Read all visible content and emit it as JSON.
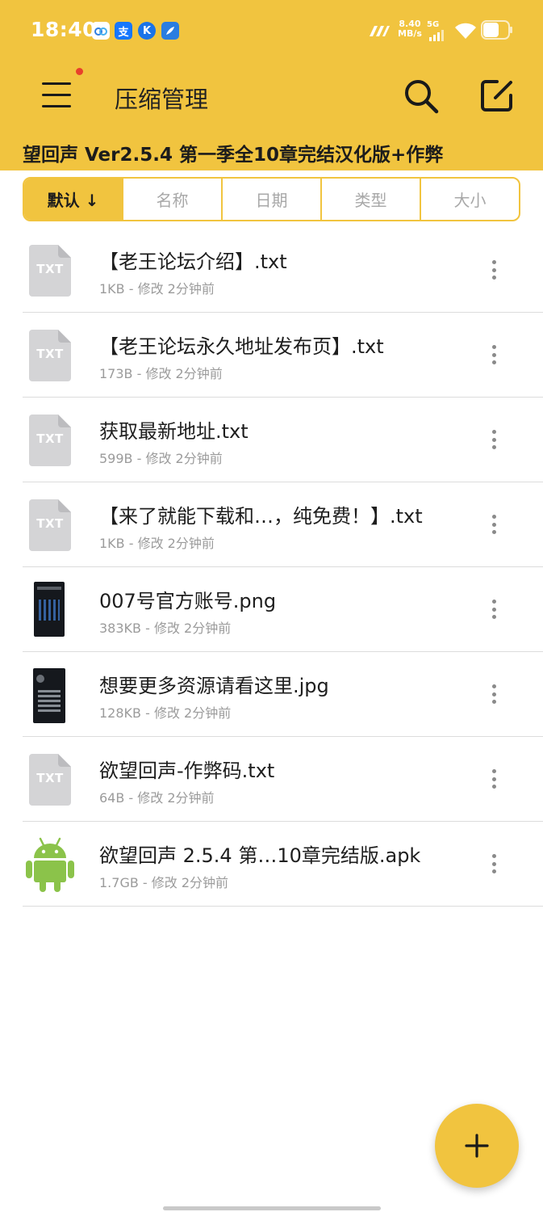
{
  "status_bar": {
    "time": "18:40",
    "apps": [
      "baidu-netdisk-icon",
      "alipay-icon",
      "k-app-icon",
      "feather-app-icon"
    ],
    "alipay_glyph": "支",
    "k_glyph": "K",
    "net_speed_value": "8.40",
    "net_speed_unit": "MB/s",
    "network": "5G",
    "battery_level": 0.6
  },
  "header": {
    "title": "压缩管理",
    "archive_path": "望回声 Ver2.5.4 第一季全10章完结汉化版+作弊",
    "has_notification": true
  },
  "sort_tabs": [
    {
      "label": "默认 ↓",
      "active": true
    },
    {
      "label": "名称",
      "active": false
    },
    {
      "label": "日期",
      "active": false
    },
    {
      "label": "类型",
      "active": false
    },
    {
      "label": "大小",
      "active": false
    }
  ],
  "files": [
    {
      "name": "【老王论坛介绍】.txt",
      "meta": "1KB - 修改 2分钟前",
      "icon": "txt-file-icon",
      "icon_label": "TXT"
    },
    {
      "name": "【老王论坛永久地址发布页】.txt",
      "meta": "173B - 修改 2分钟前",
      "icon": "txt-file-icon",
      "icon_label": "TXT"
    },
    {
      "name": "获取最新地址.txt",
      "meta": "599B - 修改 2分钟前",
      "icon": "txt-file-icon",
      "icon_label": "TXT"
    },
    {
      "name": "【来了就能下载和…，纯免费！】.txt",
      "meta": "1KB - 修改 2分钟前",
      "icon": "txt-file-icon",
      "icon_label": "TXT"
    },
    {
      "name": "007号官方账号.png",
      "meta": "383KB - 修改 2分钟前",
      "icon": "image-thumbnail"
    },
    {
      "name": "想要更多资源请看这里.jpg",
      "meta": "128KB - 修改 2分钟前",
      "icon": "image-thumbnail"
    },
    {
      "name": "欲望回声-作弊码.txt",
      "meta": "64B - 修改 2分钟前",
      "icon": "txt-file-icon",
      "icon_label": "TXT"
    },
    {
      "name": "欲望回声 2.5.4 第…10章完结版.apk",
      "meta": "1.7GB - 修改 2分钟前",
      "icon": "android-icon"
    }
  ],
  "colors": {
    "accent": "#F1C43F",
    "text_primary": "#1e1e1e",
    "text_secondary": "#9b9b9b",
    "file_icon_gray": "#d4d4d6",
    "android_green": "#8bc34a"
  }
}
